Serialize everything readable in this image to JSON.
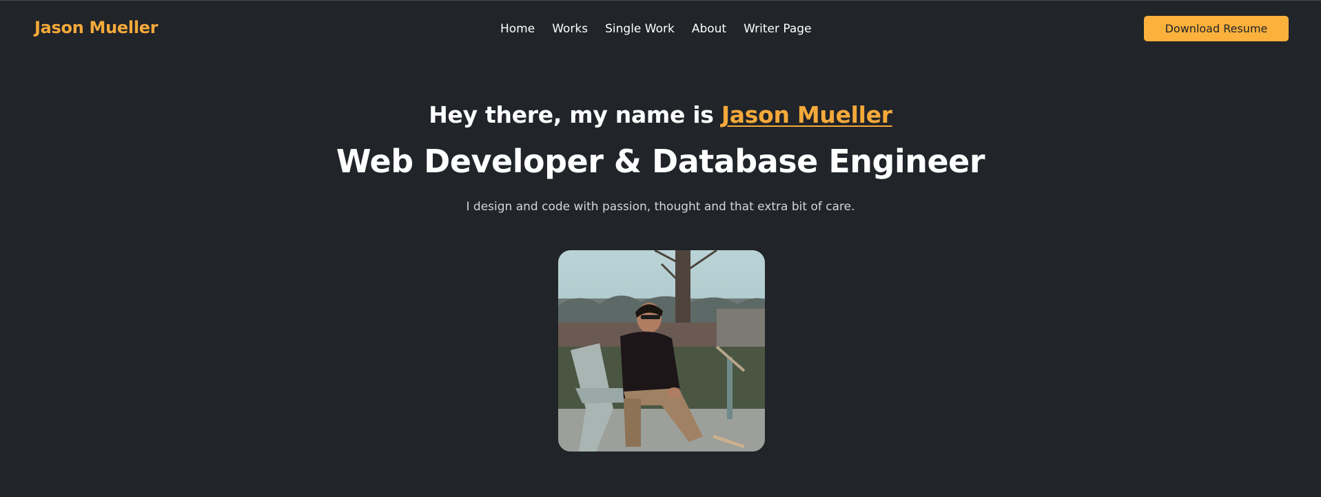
{
  "navbar": {
    "brand": "Jason Mueller",
    "links": [
      {
        "label": "Home"
      },
      {
        "label": "Works"
      },
      {
        "label": "Single Work"
      },
      {
        "label": "About"
      },
      {
        "label": "Writer Page"
      }
    ],
    "cta_label": "Download Resume"
  },
  "hero": {
    "greeting_prefix": "Hey there, my name is ",
    "greeting_name": "Jason Mueller",
    "headline": "Web Developer & Database Engineer",
    "tagline": "I design and code with passion, thought and that extra bit of care."
  },
  "colors": {
    "background": "#212429",
    "accent": "#f5a93a",
    "button": "#fbb13c",
    "text": "#ffffff"
  }
}
